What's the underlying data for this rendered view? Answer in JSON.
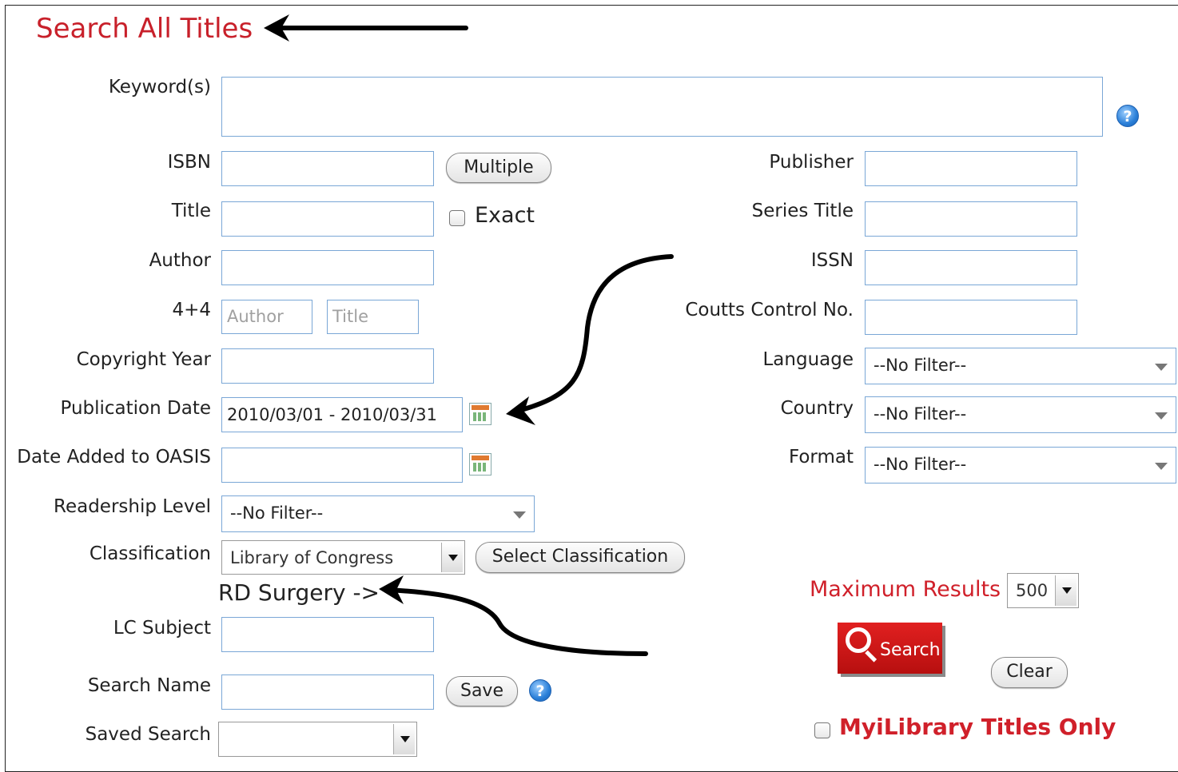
{
  "page": {
    "title": "Search All Titles"
  },
  "left": {
    "keywords_label": "Keyword(s)",
    "isbn_label": "ISBN",
    "multiple_button": "Multiple",
    "title_label": "Title",
    "exact_label": "Exact",
    "author_label": "Author",
    "fourfour_label": "4+4",
    "fourfour_author_placeholder": "Author",
    "fourfour_title_placeholder": "Title",
    "copyright_label": "Copyright Year",
    "pubdate_label": "Publication Date",
    "pubdate_value": "2010/03/01 - 2010/03/31",
    "dateadded_label": "Date Added to OASIS",
    "readership_label": "Readership Level",
    "readership_value": "--No Filter--",
    "classification_label": "Classification",
    "classification_value": "Library of Congress",
    "select_classification_button": "Select Classification",
    "rd_note": "RD Surgery ->",
    "lcsubject_label": "LC Subject",
    "searchname_label": "Search Name",
    "save_button": "Save",
    "savedsearch_label": "Saved Search"
  },
  "right": {
    "publisher_label": "Publisher",
    "series_label": "Series Title",
    "issn_label": "ISSN",
    "coutts_label": "Coutts Control No.",
    "language_label": "Language",
    "language_value": "--No Filter--",
    "country_label": "Country",
    "country_value": "--No Filter--",
    "format_label": "Format",
    "format_value": "--No Filter--",
    "maxresults_label": "Maximum Results",
    "maxresults_value": "500",
    "search_button": "Search",
    "clear_button": "Clear",
    "myilibrary_label": "MyiLibrary Titles Only"
  },
  "icons": {
    "help": "question-mark-icon",
    "calendar": "calendar-icon"
  },
  "colors": {
    "accent_red": "#c8202a",
    "field_border": "#7aa7d6"
  }
}
